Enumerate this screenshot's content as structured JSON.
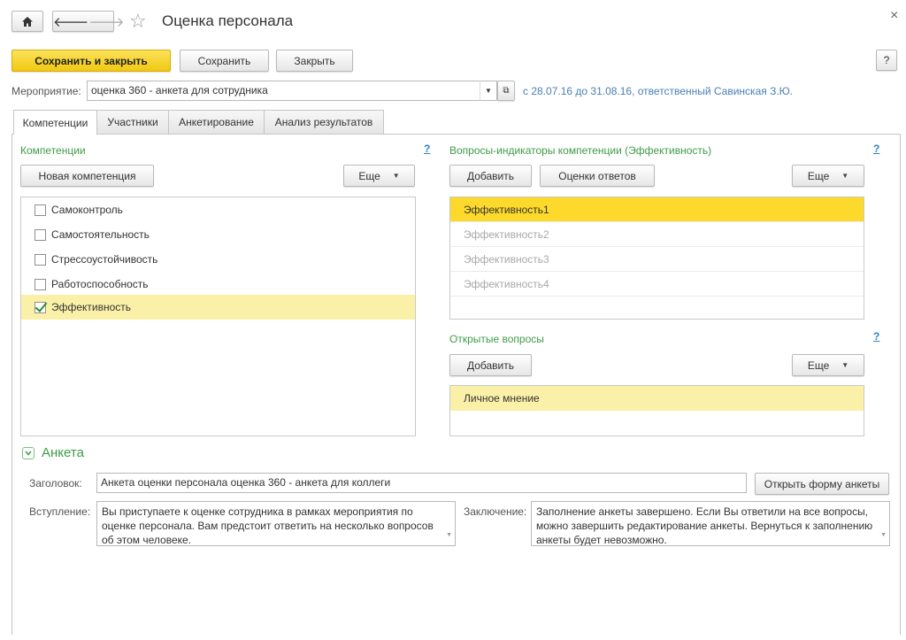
{
  "window": {
    "title": "Оценка персонала",
    "home_icon": "home-icon",
    "back_icon": "arrow-left-icon",
    "forward_icon": "arrow-right-icon",
    "star_icon": "star-icon",
    "close_icon": "close-icon",
    "close_glyph": "×"
  },
  "toolbar": {
    "save_close_label": "Сохранить и закрыть",
    "save_label": "Сохранить",
    "close_label": "Закрыть",
    "help_label": "?"
  },
  "event": {
    "label": "Мероприятие:",
    "value": "оценка 360 - анкета для сотрудника",
    "info": "с 28.07.16 до 31.08.16, ответственный Савинская З.Ю."
  },
  "tabs": [
    {
      "label": "Компетенции",
      "active": true
    },
    {
      "label": "Участники",
      "active": false
    },
    {
      "label": "Анкетирование",
      "active": false
    },
    {
      "label": "Анализ результатов",
      "active": false
    }
  ],
  "competencies": {
    "title": "Компетенции",
    "help": "?",
    "new_button": "Новая компетенция",
    "more_button": "Еще",
    "items": [
      {
        "label": "Самоконтроль",
        "checked": false
      },
      {
        "label": "Самостоятельность",
        "checked": false
      },
      {
        "label": "Стрессоустойчивость",
        "checked": false
      },
      {
        "label": "Работоспособность",
        "checked": false
      },
      {
        "label": "Эффективность",
        "checked": true
      }
    ]
  },
  "indicators": {
    "title": "Вопросы-индикаторы компетенции (Эффективность)",
    "help": "?",
    "add_button": "Добавить",
    "rates_button": "Оценки ответов",
    "more_button": "Еще",
    "items": [
      "Эффективность1",
      "Эффективность2",
      "Эффективность3",
      "Эффективность4"
    ]
  },
  "open_questions": {
    "title": "Открытые вопросы",
    "help": "?",
    "add_button": "Добавить",
    "more_button": "Еще",
    "items": [
      "Личное мнение"
    ]
  },
  "survey": {
    "section_title": "Анкета",
    "header_label": "Заголовок:",
    "header_value": "Анкета оценки персонала оценка 360 - анкета для коллеги",
    "open_form_button": "Открыть форму анкеты",
    "intro_label": "Вступление:",
    "intro_value": "Вы приступаете к оценке сотрудника в рамках мероприятия по оценке персонала. Вам предстоит ответить на несколько вопросов об этом человеке.",
    "conclusion_label": "Заключение:",
    "conclusion_value": "Заполнение анкеты завершено. Если Вы ответили на все вопросы, можно завершить редактирование анкеты. Вернуться к заполнению анкеты будет невозможно."
  },
  "colors": {
    "accent_yellow": "#f2c811",
    "section_green": "#3f9b47",
    "link_blue": "#2c83c5"
  }
}
